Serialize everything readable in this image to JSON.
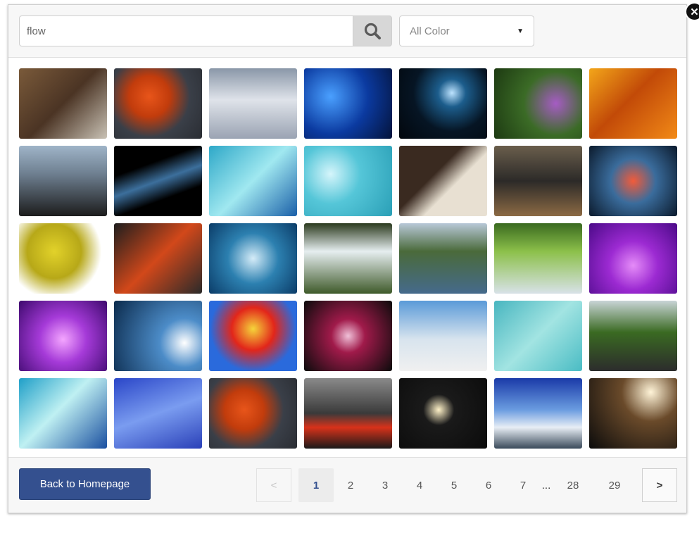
{
  "search": {
    "value": "flow",
    "placeholder": ""
  },
  "color_filter": {
    "selected": "All Color"
  },
  "gallery": {
    "thumbnails": [
      {
        "name": "canyon",
        "bg": "linear-gradient(135deg,#7a5a3a,#4b3424 50%,#c9c2b5)"
      },
      {
        "name": "lava-rock",
        "bg": "radial-gradient(circle at 40% 40%,#e8551a 0,#c23c0c 30%,#3a3f48 60%,#2a2d33)"
      },
      {
        "name": "snowy-mountains",
        "bg": "linear-gradient(180deg,#8a97a8,#dfe3ea 45%,#9aa3b3)"
      },
      {
        "name": "blue-abstract-flowers",
        "bg": "radial-gradient(circle at 30% 40%,#4aa0ff,#0b3aa0 50%,#04133a)"
      },
      {
        "name": "space-planet",
        "bg": "radial-gradient(circle at 60% 35%,#bde3ff 0,#1c5d8c 20%,#061524 55%,#02070d)"
      },
      {
        "name": "bee-on-flower",
        "bg": "radial-gradient(circle at 70% 50%,#a65cc4,#3b6b26 45%,#1d3a12)"
      },
      {
        "name": "fire",
        "bg": "linear-gradient(135deg,#f3a61a,#c24a08 45%,#f28a17)"
      },
      {
        "name": "lava-flow-sea",
        "bg": "linear-gradient(180deg,#9fb4c8,#6e7f90 40%,#1c1c1c)"
      },
      {
        "name": "dark-light-streaks",
        "bg": "linear-gradient(160deg,#000 30%,#3c6f9c 50%,#000 70%)"
      },
      {
        "name": "teal-wave",
        "bg": "linear-gradient(135deg,#2ea8c8,#a0e8f0 50%,#1a5fa8)"
      },
      {
        "name": "cyan-bokeh",
        "bg": "radial-gradient(circle at 30% 40%,#d5f5fb,#55c6d8 40%,#2a9fb6)"
      },
      {
        "name": "rock-on-sand",
        "bg": "linear-gradient(135deg,#3a2a20 40%,#e8e0d2 60%)"
      },
      {
        "name": "silver-car",
        "bg": "linear-gradient(180deg,#6a5e4c,#2c2a28 50%,#8c6a44)"
      },
      {
        "name": "red-swirl",
        "bg": "radial-gradient(circle at 50% 50%,#f25b3a,#3a6c9c 40%,#0b1a2c)"
      },
      {
        "name": "starfruit",
        "bg": "radial-gradient(circle at 40% 40%,#e2d22a,#b7a818 40%,#ffffff 70%)"
      },
      {
        "name": "fiery-abstract",
        "bg": "linear-gradient(135deg,#1e1e1e,#d2481a 50%,#2a2a2a)"
      },
      {
        "name": "water-splash",
        "bg": "radial-gradient(circle at 50% 50%,#d5ecf8,#2c80b0 45%,#0b3c68)"
      },
      {
        "name": "waterfall",
        "bg": "linear-gradient(180deg,#2b3a1e,#e6eef0 40%,#3f5a2a)"
      },
      {
        "name": "river-mountains",
        "bg": "linear-gradient(180deg,#b8c8d8,#4a6a3a 40%,#456a8c)"
      },
      {
        "name": "mossy-stream",
        "bg": "linear-gradient(180deg,#3a6a20,#8cc04a 40%,#d8e2e8)"
      },
      {
        "name": "purple-lights",
        "bg": "radial-gradient(circle at 50% 60%,#e58cf8,#9c2ad2 40%,#4b0a88)"
      },
      {
        "name": "purple-glow",
        "bg": "radial-gradient(circle at 50% 55%,#f4a6ff,#a53ad8 40%,#3e0a6e)"
      },
      {
        "name": "blue-light-burst",
        "bg": "radial-gradient(circle at 80% 60%,#ffffff,#4c8cc8 30%,#0b2a4c)"
      },
      {
        "name": "fractal",
        "bg": "radial-gradient(circle at 50% 40%,#f5d43a,#e2261a 35%,#2a6adc 70%)"
      },
      {
        "name": "pink-streaks",
        "bg": "radial-gradient(circle at 50% 50%,#f0c0d8,#a01a4a 30%,#0b0b0b)"
      },
      {
        "name": "fighter-jet",
        "bg": "linear-gradient(180deg,#5a9ad8,#d8e4ee 55%,#f0f0f0)"
      },
      {
        "name": "teal-abstract",
        "bg": "linear-gradient(135deg,#48b6c0,#a2e4e2 50%,#4abcc4)"
      },
      {
        "name": "stream-hills",
        "bg": "linear-gradient(180deg,#c8d4d6,#3a6a22 45%,#2c2c2c)"
      },
      {
        "name": "teal-wave-2",
        "bg": "linear-gradient(135deg,#1f9fc8,#bff0f2 45%,#1a4fa0)"
      },
      {
        "name": "blue-silk",
        "bg": "linear-gradient(160deg,#2a46c8,#7a9cf0 50%,#2a40b8)"
      },
      {
        "name": "lava-rock-2",
        "bg": "radial-gradient(circle at 40% 45%,#e8551a 0,#c23c0c 30%,#3a3f48 60%,#2a2d33)"
      },
      {
        "name": "volcano-lava",
        "bg": "linear-gradient(180deg,#8a8a8a,#3a3a3a 50%,#d8321a 70%,#1a1a1a)"
      },
      {
        "name": "glowing-jellyfish",
        "bg": "radial-gradient(circle at 45% 45%,#fff2c8,#1a1a1a 25%,#0b0b0b)"
      },
      {
        "name": "snowy-peak",
        "bg": "linear-gradient(180deg,#1a3aa8,#6a9ce0 45%,#e8eef5 70%,#3a4a5a)"
      },
      {
        "name": "light-rays",
        "bg": "radial-gradient(circle at 70% 20%,#fff4d8,#6a4a2a 35%,#0b0b0b)"
      }
    ]
  },
  "footer": {
    "back_label": "Back to Homepage",
    "prev_label": "<",
    "next_label": ">",
    "pages": [
      "1",
      "2",
      "3",
      "4",
      "5",
      "6",
      "7"
    ],
    "ellipsis": "...",
    "last_pages": [
      "28",
      "29"
    ],
    "active_page": "1"
  },
  "colors": {
    "primary": "#34508f",
    "close_bg": "#111111"
  },
  "icons": {
    "search": "search-icon",
    "close": "close-icon",
    "caret": "chevron-down-icon"
  }
}
